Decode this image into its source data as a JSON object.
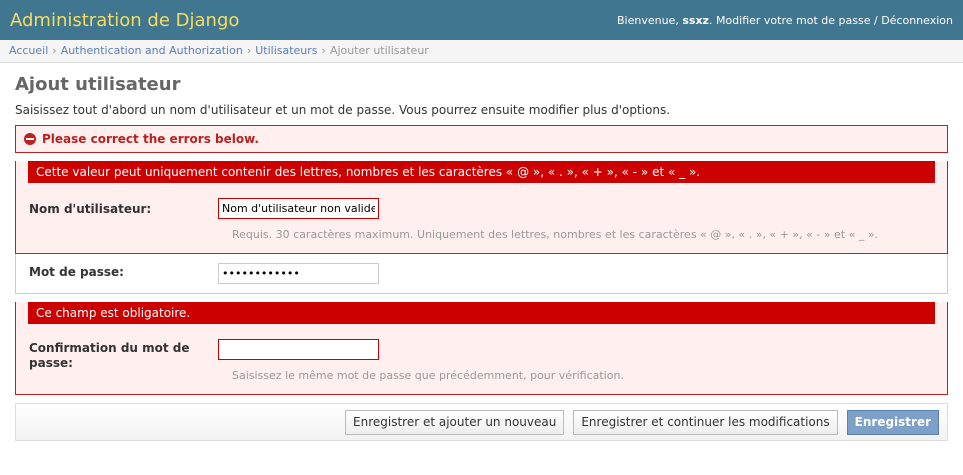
{
  "header": {
    "site_name": "Administration de Django",
    "welcome": "Bienvenue,",
    "username": "ssxz",
    "change_password": "Modifier votre mot de passe",
    "separator": "/",
    "logout": "Déconnexion"
  },
  "breadcrumbs": {
    "items": [
      "Accueil",
      "Authentication and Authorization",
      "Utilisateurs"
    ],
    "current": "Ajouter utilisateur",
    "sep": "›"
  },
  "page": {
    "title": "Ajout utilisateur",
    "intro": "Saisissez tout d'abord un nom d'utilisateur et un mot de passe. Vous pourrez ensuite modifier plus d'options.",
    "error_note": "Please correct the errors below."
  },
  "form": {
    "username": {
      "error": "Cette valeur peut uniquement contenir des lettres, nombres et les caractères « @ », « . », « + », « - » et « _ ».",
      "label": "Nom d'utilisateur:",
      "value": "Nom d'utilisateur non valide",
      "help": "Requis. 30 caractères maximum. Uniquement des lettres, nombres et les caractères « @ », « . », « + », « - » et « _ »."
    },
    "password1": {
      "label": "Mot de passe:",
      "value": "ssssssssssss"
    },
    "password2": {
      "error": "Ce champ est obligatoire.",
      "label_line1": "Confirmation du mot de",
      "label_line2": "passe:",
      "value": "",
      "help": "Saisissez le même mot de passe que précédemment, pour vérification."
    }
  },
  "buttons": {
    "save_add": "Enregistrer et ajouter un nouveau",
    "save_continue": "Enregistrer et continuer les modifications",
    "save": "Enregistrer"
  },
  "colors": {
    "header_bg": "#417690",
    "site_name": "#f5dd5d",
    "link": "#5b80b2",
    "error": "#ba2121",
    "error_bar": "#cc0000",
    "error_bg": "#ffefef",
    "default_button": "#7ca0c7"
  }
}
